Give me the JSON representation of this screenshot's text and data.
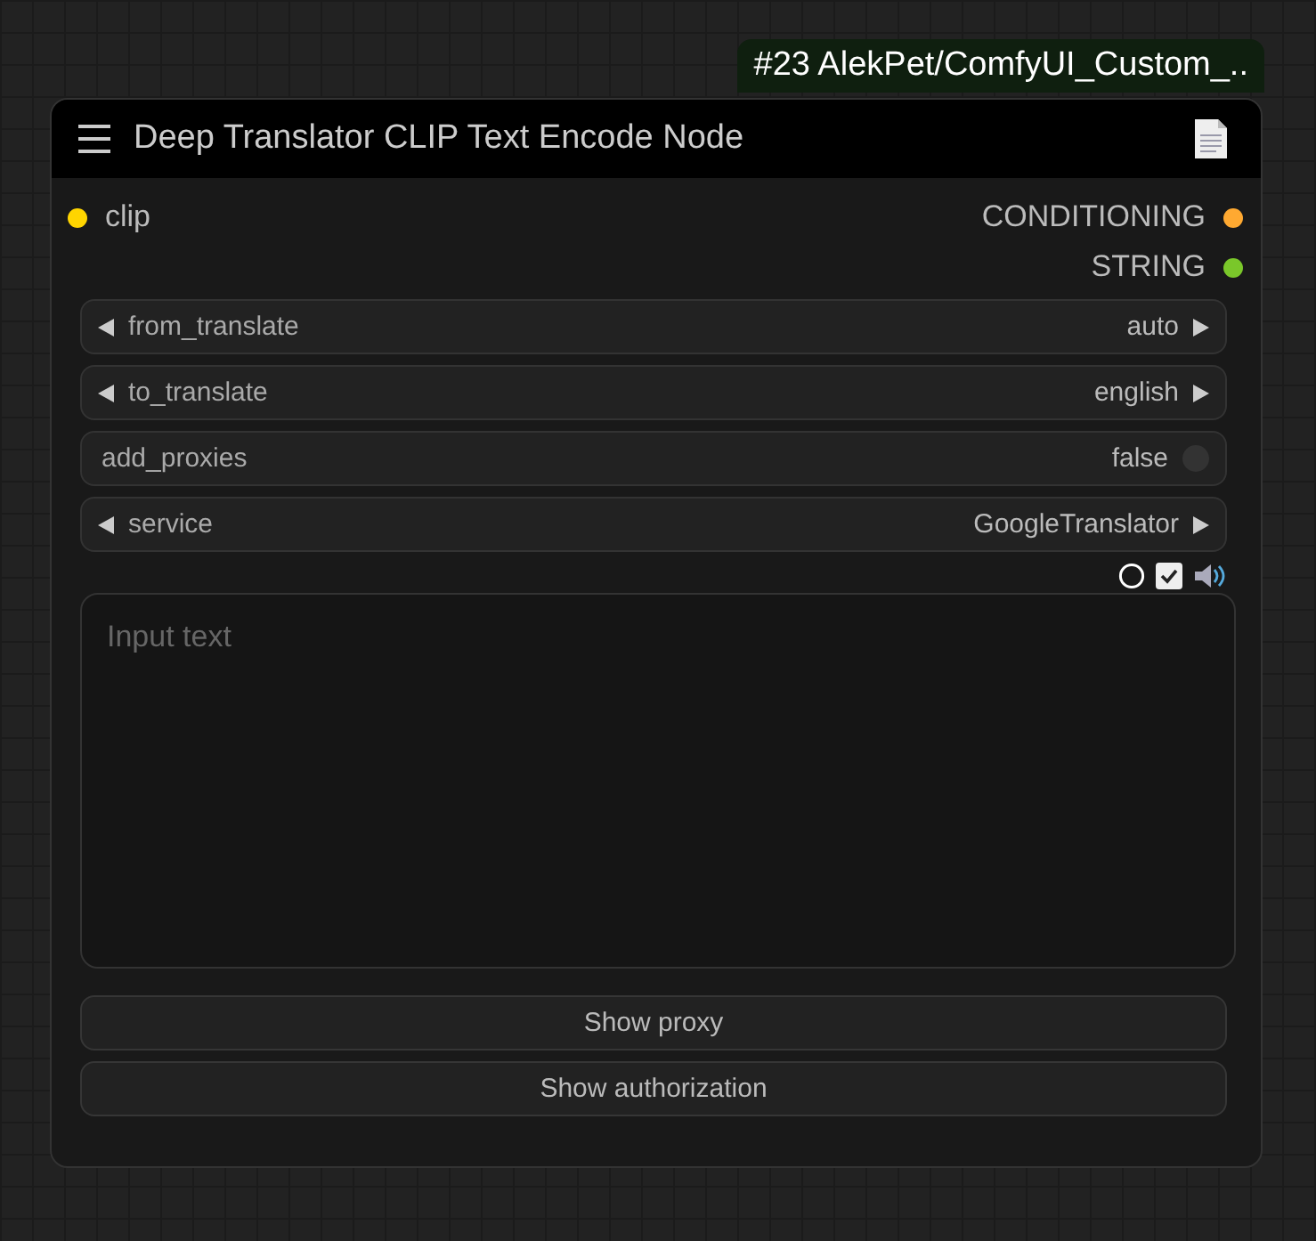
{
  "badge": "#23 AlekPet/ComfyUI_Custom_..",
  "node": {
    "title": "Deep Translator CLIP Text Encode Node"
  },
  "inputs": [
    {
      "label": "clip",
      "color": "#ffd500"
    }
  ],
  "outputs": [
    {
      "label": "CONDITIONING",
      "color": "#ffa931"
    },
    {
      "label": "STRING",
      "color": "#7ac72a"
    }
  ],
  "widgets": [
    {
      "kind": "combo",
      "label": "from_translate",
      "value": "auto"
    },
    {
      "kind": "combo",
      "label": "to_translate",
      "value": "english"
    },
    {
      "kind": "toggle",
      "label": "add_proxies",
      "value": "false",
      "on": false
    },
    {
      "kind": "combo",
      "label": "service",
      "value": "GoogleTranslator"
    }
  ],
  "text_tools": {
    "checked": true
  },
  "text_input": {
    "placeholder": "Input text"
  },
  "buttons": [
    "Show proxy",
    "Show authorization"
  ]
}
